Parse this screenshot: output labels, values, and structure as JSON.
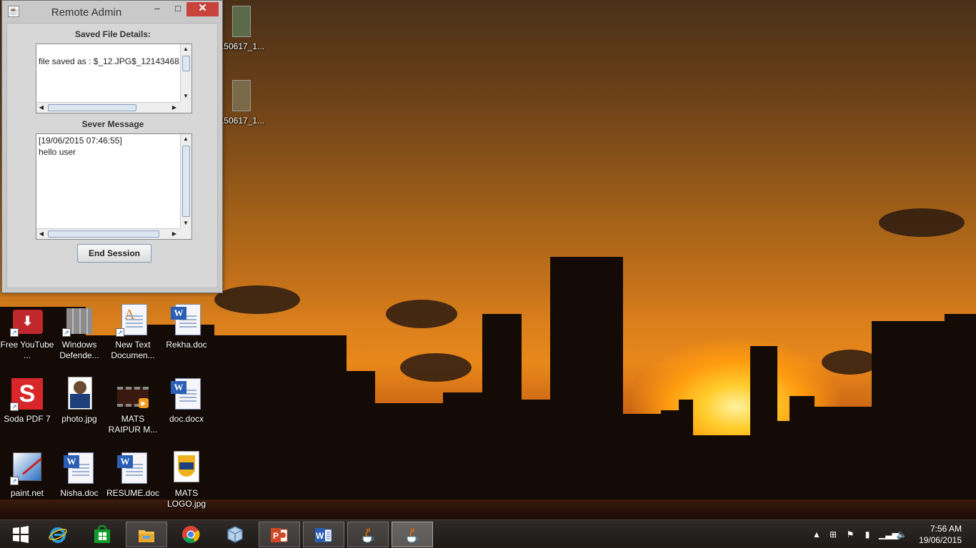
{
  "window": {
    "title": "Remote Admin",
    "controls": {
      "minimize": "–",
      "maximize": "□",
      "close": "✕"
    },
    "saved_file_label": "Saved File Details:",
    "saved_file_text": "file saved as : $_12.JPG$_12143468",
    "server_message_label": "Sever Message",
    "server_message_lines": [
      "[19/06/2015 07:46:55]",
      "hello user"
    ],
    "end_session_label": "End Session"
  },
  "desktop_icons": [
    {
      "label": "0150617_1...",
      "icon": "image-thumbnail-icon"
    },
    {
      "label": "0150617_1...",
      "icon": "image-thumbnail-icon"
    },
    {
      "label": "Free YouTube ...",
      "icon": "youtube-downloader-icon"
    },
    {
      "label": "Windows Defende...",
      "icon": "windows-defender-icon"
    },
    {
      "label": "New Text Documen...",
      "icon": "text-document-icon"
    },
    {
      "label": "Rekha.doc",
      "icon": "word-document-icon"
    },
    {
      "label": "Soda PDF 7",
      "icon": "soda-pdf-icon"
    },
    {
      "label": "photo.jpg",
      "icon": "photo-icon"
    },
    {
      "label": "MATS RAIPUR M...",
      "icon": "video-file-icon"
    },
    {
      "label": "doc.docx",
      "icon": "word-document-icon"
    },
    {
      "label": "paint.net",
      "icon": "paint-net-icon"
    },
    {
      "label": "Nisha.doc",
      "icon": "word-document-icon"
    },
    {
      "label": "RESUME.doc",
      "icon": "word-document-icon"
    },
    {
      "label": "MATS LOGO.jpg",
      "icon": "mats-logo-icon"
    }
  ],
  "taskbar": {
    "items": [
      "start-icon",
      "internet-explorer-icon",
      "store-icon",
      "file-explorer-icon",
      "chrome-icon",
      "virtualbox-icon",
      "powerpoint-icon",
      "word-icon",
      "java-icon",
      "java-icon"
    ],
    "clock_time": "7:56 AM",
    "clock_date": "19/06/2015"
  },
  "colors": {
    "close_button": "#c7433b",
    "taskbar": "#2a2624",
    "sky_orange": "#d97f1c"
  }
}
